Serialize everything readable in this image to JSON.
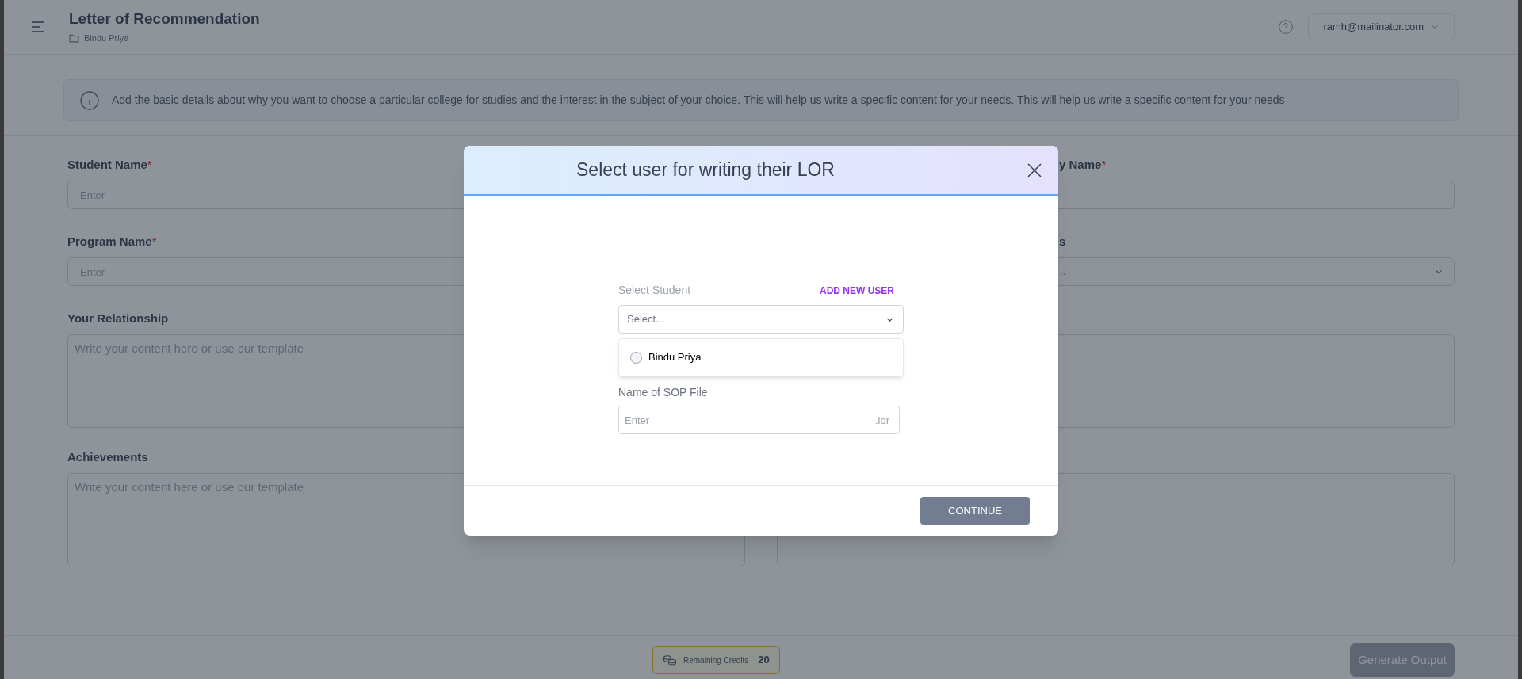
{
  "header": {
    "title": "Letter of Recommendation",
    "breadcrumb": "Bindu Priya",
    "user_email": "ramh@mailinator.com"
  },
  "info_banner": {
    "text": "Add the basic details about why you want to choose a particular college for studies and the interest in the subject of your choice. This will help us write a specific content for your needs. This will help us write a specific content for your needs"
  },
  "form": {
    "left_fields": [
      {
        "kind": "input",
        "label": "Student Name",
        "required_mark": "*",
        "placeholder": "Enter"
      },
      {
        "kind": "input",
        "label": "Program Name",
        "required_mark": "*",
        "placeholder": "Enter"
      },
      {
        "kind": "textarea",
        "label": "Your Relationship",
        "placeholder": "Write your content here or use our template"
      },
      {
        "kind": "textarea",
        "label": "Achievements",
        "placeholder": "Write your content here or use our template"
      }
    ],
    "right_fields": [
      {
        "kind": "input",
        "label": "y Name",
        "required_mark": "*"
      },
      {
        "kind": "select",
        "label": "s",
        "placeholder": ".."
      },
      {
        "kind": "textarea"
      },
      {
        "kind": "textarea"
      }
    ]
  },
  "footer": {
    "credits_label": "Remaining Credits",
    "credits_value": "20",
    "generate_button": "Generate Output"
  },
  "modal": {
    "title": "Select user for writing their LOR",
    "student_label": "Select Student",
    "add_user_link": "ADD NEW USER",
    "select_placeholder": "Select...",
    "options": [
      {
        "label": "Bindu Priya",
        "selected": false
      }
    ],
    "file_label": "Name of SOP File",
    "file_placeholder": "Enter",
    "file_suffix": ".lor",
    "continue_button": "CONTINUE"
  }
}
